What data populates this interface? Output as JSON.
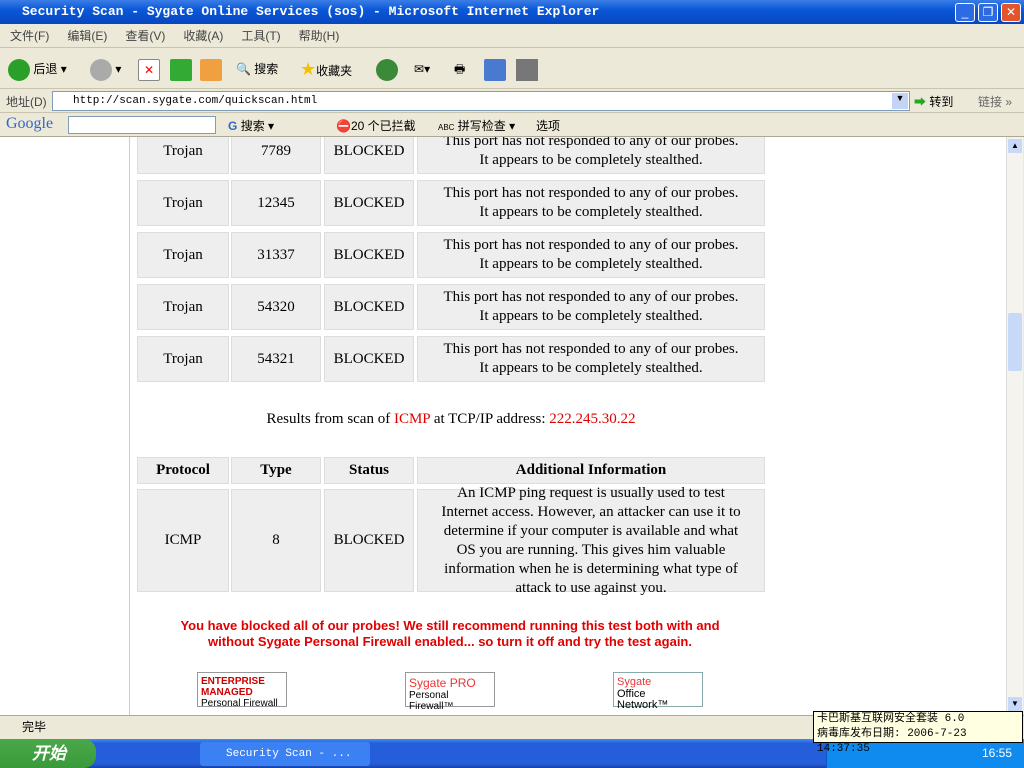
{
  "window": {
    "title": "Security Scan - Sygate Online Services (sos) - Microsoft Internet Explorer"
  },
  "menu": [
    "文件(F)",
    "编辑(E)",
    "查看(V)",
    "收藏(A)",
    "工具(T)",
    "帮助(H)"
  ],
  "toolbar": {
    "back": "后退",
    "search": "搜索",
    "favorites": "收藏夹"
  },
  "address": {
    "label": "地址(D)",
    "url": "http://scan.sygate.com/quickscan.html",
    "go": "转到",
    "links": "链接"
  },
  "google": {
    "logo": "Google",
    "search": "搜索",
    "blocked": "20 个已拦截",
    "spell": "拼写检查",
    "options": "选项"
  },
  "tcp_rows": [
    {
      "type": "Trojan",
      "port": "7789",
      "status": "BLOCKED",
      "info": "This port has not responded to any of our probes. It appears to be completely stealthed."
    },
    {
      "type": "Trojan",
      "port": "12345",
      "status": "BLOCKED",
      "info": "This port has not responded to any of our probes. It appears to be completely stealthed."
    },
    {
      "type": "Trojan",
      "port": "31337",
      "status": "BLOCKED",
      "info": "This port has not responded to any of our probes. It appears to be completely stealthed."
    },
    {
      "type": "Trojan",
      "port": "54320",
      "status": "BLOCKED",
      "info": "This port has not responded to any of our probes. It appears to be completely stealthed."
    },
    {
      "type": "Trojan",
      "port": "54321",
      "status": "BLOCKED",
      "info": "This port has not responded to any of our probes. It appears to be completely stealthed."
    }
  ],
  "results": {
    "prefix": "Results from scan of ",
    "protocol": "ICMP",
    "middle": " at TCP/IP address: ",
    "ip": "222.245.30.22"
  },
  "icmp_table": {
    "headers": [
      "Protocol",
      "Type",
      "Status",
      "Additional Information"
    ],
    "row": {
      "protocol": "ICMP",
      "type": "8",
      "status": "BLOCKED",
      "info": "An ICMP ping request is usually used to test Internet access. However, an attacker can use it to determine if your computer is available and what OS you are running. This gives him valuable information when he is determining what type of attack to use against you."
    }
  },
  "notice": "You have blocked all of our probes! We still recommend running this test both with and without Sygate Personal Firewall enabled... so turn it off and try the test again.",
  "logos": [
    {
      "l1": "ENTERPRISE",
      "l2": "MANAGED",
      "l3": "Personal Firewall"
    },
    {
      "l1": "Sygate PRO",
      "l2": "Personal Firewall™"
    },
    {
      "l1": "Sygate",
      "l2": "Office Network™"
    }
  ],
  "status": "完毕",
  "taskbar": {
    "start": "开始",
    "task": "Security Scan - ...",
    "clock": "16:55"
  },
  "tooltip": {
    "line1": "卡巴斯基互联网安全套装 6.0",
    "line2": "病毒库发布日期: 2006-7-23 14:37:35"
  },
  "colors": {
    "accent_red": "#e00000"
  }
}
